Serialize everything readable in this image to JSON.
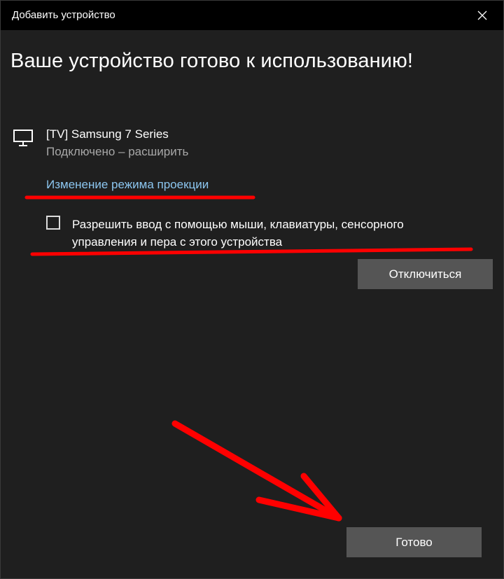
{
  "window": {
    "title": "Добавить устройство",
    "close_icon": "close-icon"
  },
  "content": {
    "heading": "Ваше устройство готово к использованию!",
    "device": {
      "icon": "monitor-icon",
      "name": "[TV] Samsung 7 Series",
      "status": "Подключено – расширить"
    },
    "projection_link": "Изменение режима проекции",
    "allow_input": {
      "checked": false,
      "label": "Разрешить ввод с помощью мыши, клавиатуры, сенсорного управления и пера с этого устройства"
    },
    "disconnect_button": "Отключиться",
    "done_button": "Готово"
  },
  "colors": {
    "background": "#1f1f1f",
    "titlebar": "#000000",
    "link": "#8cc6f0",
    "button": "#555555",
    "annotation": "#ff0000"
  }
}
